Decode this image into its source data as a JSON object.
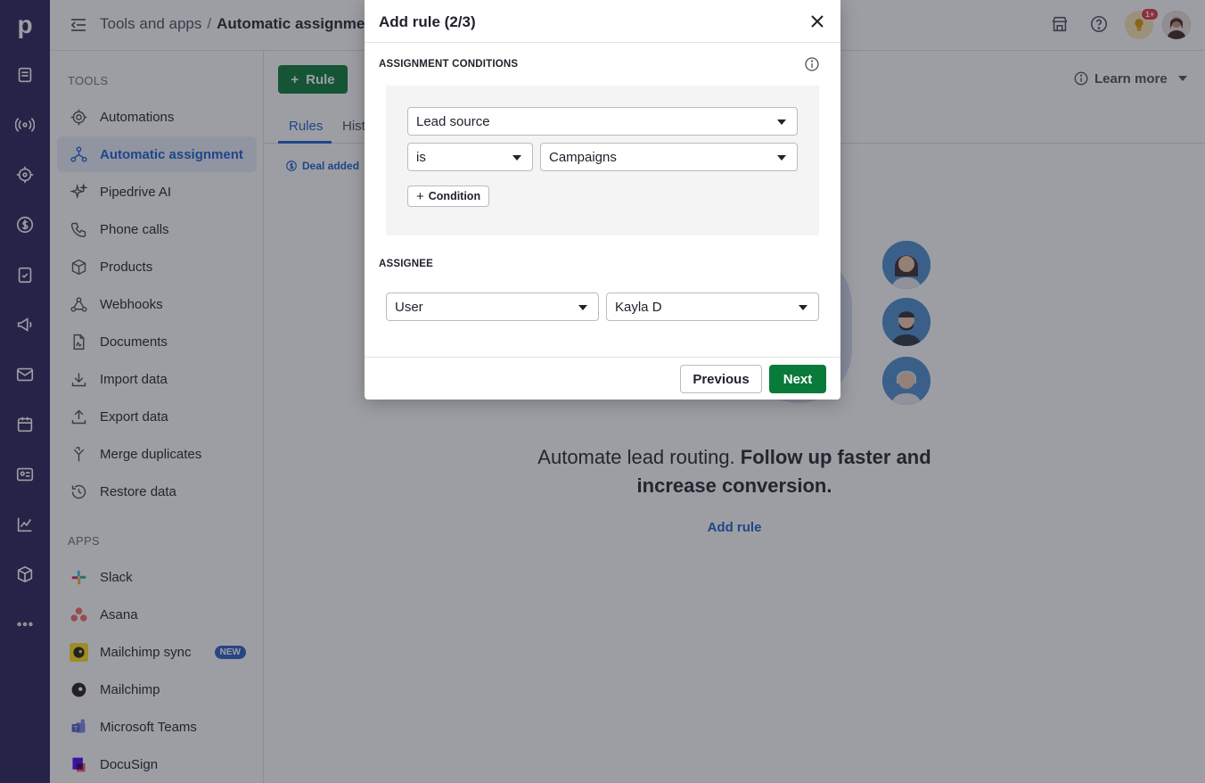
{
  "app": {
    "logo_letter": "p"
  },
  "header": {
    "breadcrumb_parent": "Tools and apps",
    "breadcrumb_separator": "/",
    "breadcrumb_current": "Automatic assignment",
    "notification_count": "1+"
  },
  "sidebar": {
    "tools_heading": "TOOLS",
    "tools": [
      {
        "label": "Automations",
        "icon": "automations-icon"
      },
      {
        "label": "Automatic assignment",
        "icon": "assignment-icon",
        "active": true
      },
      {
        "label": "Pipedrive AI",
        "icon": "sparkle-icon"
      },
      {
        "label": "Phone calls",
        "icon": "phone-icon"
      },
      {
        "label": "Products",
        "icon": "box-icon"
      },
      {
        "label": "Webhooks",
        "icon": "webhook-icon"
      },
      {
        "label": "Documents",
        "icon": "document-icon"
      },
      {
        "label": "Import data",
        "icon": "download-icon"
      },
      {
        "label": "Export data",
        "icon": "upload-icon"
      },
      {
        "label": "Merge duplicates",
        "icon": "merge-icon"
      },
      {
        "label": "Restore data",
        "icon": "restore-icon"
      }
    ],
    "apps_heading": "APPS",
    "apps": [
      {
        "label": "Slack",
        "icon": "slack-icon"
      },
      {
        "label": "Asana",
        "icon": "asana-icon"
      },
      {
        "label": "Mailchimp sync",
        "icon": "mailchimp-icon",
        "tag": "NEW"
      },
      {
        "label": "Mailchimp",
        "icon": "mailchimp-mono-icon"
      },
      {
        "label": "Microsoft Teams",
        "icon": "teams-icon"
      },
      {
        "label": "DocuSign",
        "icon": "docusign-icon"
      }
    ]
  },
  "main": {
    "rule_button": "Rule",
    "tabs": [
      "Rules",
      "Hist"
    ],
    "learn_more": "Learn more",
    "chip_text": "Deal added",
    "tagline_plain": "Automate lead routing. ",
    "tagline_bold": "Follow up faster and increase conversion.",
    "add_rule_link": "Add rule"
  },
  "modal": {
    "title": "Add rule (2/3)",
    "conditions_label": "ASSIGNMENT CONDITIONS",
    "field_value": "Lead source",
    "operator_value": "is",
    "condition_value": "Campaigns",
    "add_condition_label": "Condition",
    "assignee_label": "ASSIGNEE",
    "assignee_type_value": "User",
    "assignee_value": "Kayla D",
    "previous_label": "Previous",
    "next_label": "Next"
  },
  "colors": {
    "rail": "#26225a",
    "primary_green": "#087a3a",
    "link_blue": "#1a5fd0",
    "active_bg": "#e8eefb"
  }
}
